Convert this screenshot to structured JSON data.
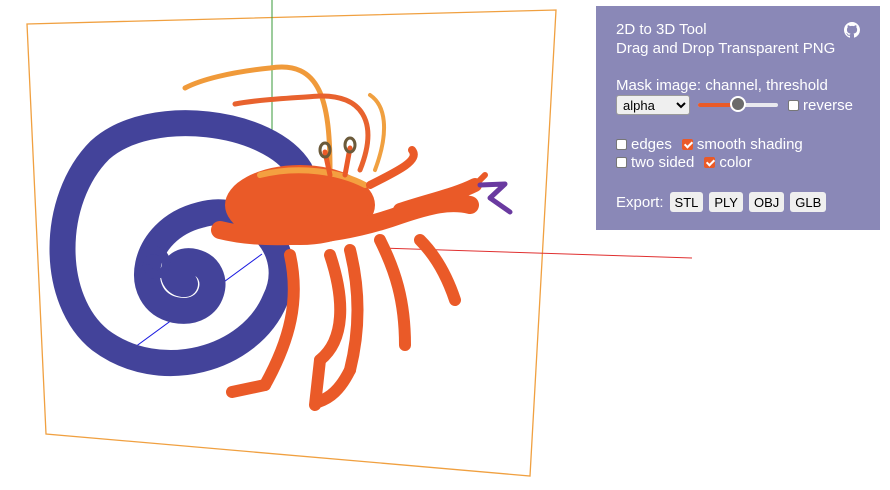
{
  "viewport": {
    "axes": {
      "x_color": "#e03030",
      "y_color": "#3a9a3a",
      "z_color": "#1a1ae0"
    },
    "frame_color": "#f0a040",
    "model": {
      "body_color": "#ea5a28",
      "shell_color": "#43439a",
      "eye_color": "#6b5a3a",
      "claw_tip_color": "#6a3aa0"
    }
  },
  "panel": {
    "title": "2D to 3D Tool",
    "subtitle": "Drag and Drop Transparent PNG",
    "github_icon": "github-icon",
    "mask_label": "Mask image: channel, threshold",
    "channel_selected": "alpha",
    "threshold": 0.5,
    "reverse_label": "reverse",
    "reverse_checked": false,
    "options": {
      "edges": {
        "label": "edges",
        "checked": false
      },
      "smooth": {
        "label": "smooth shading",
        "checked": true
      },
      "two_sided": {
        "label": "two sided",
        "checked": false
      },
      "color": {
        "label": "color",
        "checked": true
      }
    },
    "export_label": "Export:",
    "export_buttons": {
      "stl": "STL",
      "ply": "PLY",
      "obj": "OBJ",
      "glb": "GLB"
    },
    "accent": "#ea5a28",
    "background": "#8a88b7"
  }
}
